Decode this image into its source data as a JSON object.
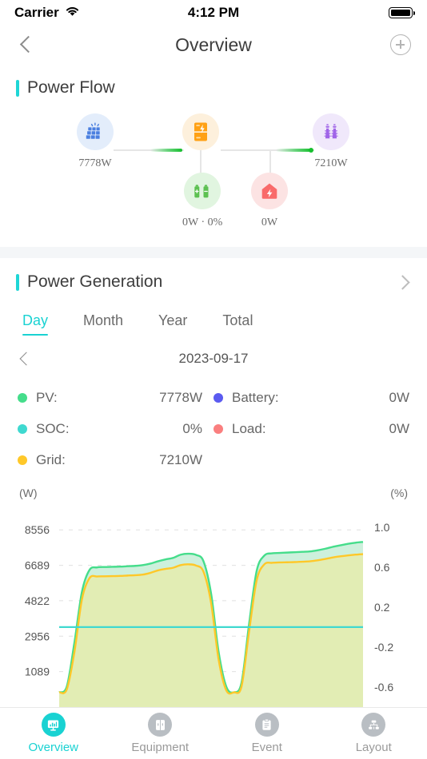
{
  "status_bar": {
    "carrier": "Carrier",
    "time": "4:12 PM",
    "wifi_icon": "wifi-icon",
    "battery_icon": "battery-full-icon"
  },
  "nav": {
    "title": "Overview",
    "back_icon": "chevron-left-icon",
    "add_icon": "plus-circle-icon"
  },
  "power_flow": {
    "title": "Power Flow",
    "nodes": [
      {
        "key": "pv",
        "icon": "solar-panel-icon",
        "value": "7778W"
      },
      {
        "key": "inverter",
        "icon": "inverter-icon",
        "value": ""
      },
      {
        "key": "grid",
        "icon": "grid-tower-icon",
        "value": "7210W"
      },
      {
        "key": "battery",
        "icon": "battery-pack-icon",
        "value": "0W · 0%"
      },
      {
        "key": "home",
        "icon": "home-load-icon",
        "value": "0W"
      }
    ]
  },
  "power_generation": {
    "title": "Power Generation",
    "chevron_icon": "chevron-right-icon",
    "tabs": [
      {
        "label": "Day",
        "active": true
      },
      {
        "label": "Month",
        "active": false
      },
      {
        "label": "Year",
        "active": false
      },
      {
        "label": "Total",
        "active": false
      }
    ],
    "date": "2023-09-17",
    "prev_icon": "chevron-left-icon",
    "legend": [
      {
        "label": "PV:",
        "value": "7778W",
        "color": "#45dd8b"
      },
      {
        "label": "Battery:",
        "value": "0W",
        "color": "#5b5bf0"
      },
      {
        "label": "SOC:",
        "value": "0%",
        "color": "#3fd9d0"
      },
      {
        "label": "Load:",
        "value": "0W",
        "color": "#fa7f7f"
      },
      {
        "label": "Grid:",
        "value": "7210W",
        "color": "#ffc829"
      }
    ]
  },
  "chart_data": {
    "type": "area",
    "title": "Power Generation",
    "xlabel": "",
    "ylabel": "(W)",
    "y2label": "(%)",
    "ylim": [
      -777,
      9490
    ],
    "y2lim": [
      -0.8,
      1.15
    ],
    "yticks": [
      "8556",
      "6689",
      "4822",
      "2956",
      "1089"
    ],
    "ytick_values": [
      8556,
      6689,
      4822,
      2956,
      1089
    ],
    "y2ticks": [
      "1.0",
      "0.6",
      "0.2",
      "-0.2",
      "-0.6"
    ],
    "y2tick_values": [
      1.0,
      0.6,
      0.2,
      -0.2,
      -0.6
    ],
    "grid": true,
    "legend_position": "above-chart",
    "x": [
      0,
      1,
      2,
      3,
      4,
      5,
      6,
      7,
      8,
      9,
      10,
      11,
      12,
      13,
      14,
      15,
      16,
      17,
      18,
      19,
      20,
      21,
      22,
      23,
      24,
      25,
      26,
      27,
      28,
      29,
      30,
      31,
      32,
      33,
      34,
      35,
      36,
      37,
      38,
      39,
      40
    ],
    "series": [
      {
        "name": "PV",
        "color": "#45dd8b",
        "fill": "#cdf0dc",
        "axis": "left",
        "values": [
          0,
          300,
          2600,
          5300,
          6450,
          6580,
          6600,
          6610,
          6620,
          6640,
          6660,
          6700,
          6780,
          6900,
          7000,
          7080,
          7250,
          7300,
          7240,
          6900,
          5200,
          2100,
          300,
          0,
          500,
          3600,
          6400,
          7200,
          7320,
          7340,
          7360,
          7380,
          7400,
          7420,
          7480,
          7560,
          7660,
          7740,
          7820,
          7880,
          7920
        ]
      },
      {
        "name": "Grid",
        "color": "#ffc829",
        "fill": "#e2edb4",
        "axis": "left",
        "values": [
          0,
          150,
          2100,
          4900,
          6020,
          6100,
          6110,
          6120,
          6130,
          6150,
          6170,
          6200,
          6290,
          6420,
          6500,
          6560,
          6700,
          6740,
          6680,
          6350,
          4700,
          1700,
          100,
          0,
          300,
          3200,
          5900,
          6740,
          6820,
          6840,
          6850,
          6860,
          6880,
          6900,
          6950,
          7020,
          7100,
          7160,
          7210,
          7250,
          7280
        ]
      },
      {
        "name": "SOC",
        "color": "#3fd9d0",
        "axis": "right",
        "values": [
          0,
          0,
          0,
          0,
          0,
          0,
          0,
          0,
          0,
          0,
          0,
          0,
          0,
          0,
          0,
          0,
          0,
          0,
          0,
          0,
          0,
          0,
          0,
          0,
          0,
          0,
          0,
          0,
          0,
          0,
          0,
          0,
          0,
          0,
          0,
          0,
          0,
          0,
          0,
          0,
          0
        ]
      }
    ]
  },
  "tab_bar": [
    {
      "label": "Overview",
      "icon": "monitor-chart-icon",
      "active": true
    },
    {
      "label": "Equipment",
      "icon": "cabinet-icon",
      "active": false
    },
    {
      "label": "Event",
      "icon": "clipboard-icon",
      "active": false
    },
    {
      "label": "Layout",
      "icon": "hierarchy-icon",
      "active": false
    }
  ]
}
